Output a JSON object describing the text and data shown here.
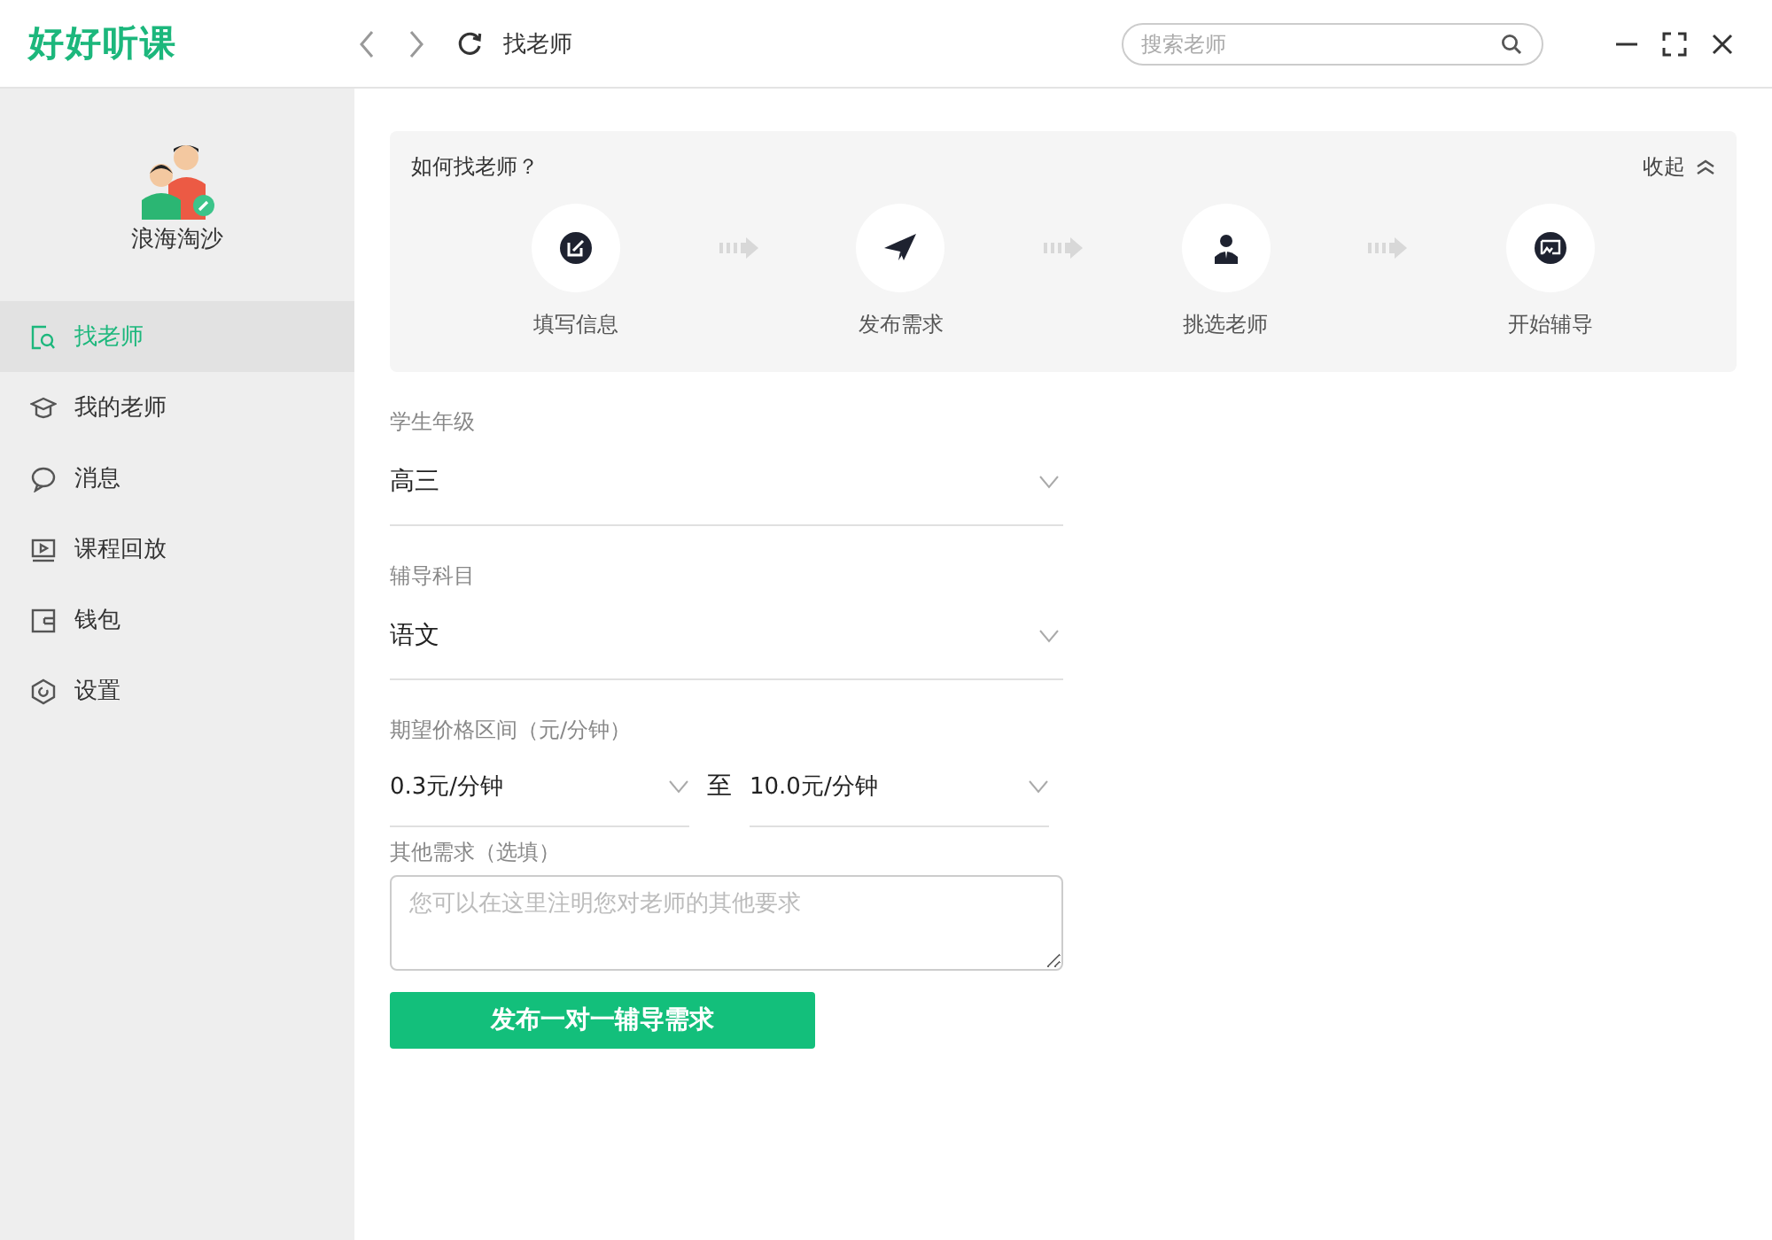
{
  "app": {
    "logo": "好好听课"
  },
  "toolbar": {
    "page_title": "找老师",
    "search": {
      "placeholder": "搜索老师"
    }
  },
  "sidebar": {
    "user": {
      "name": "浪海淘沙"
    },
    "items": [
      {
        "label": "找老师",
        "kind": "find",
        "selected": true
      },
      {
        "label": "我的老师",
        "kind": "teachers",
        "selected": false
      },
      {
        "label": "消息",
        "kind": "messages",
        "selected": false
      },
      {
        "label": "课程回放",
        "kind": "playback",
        "selected": false
      },
      {
        "label": "钱包",
        "kind": "wallet",
        "selected": false
      },
      {
        "label": "设置",
        "kind": "settings",
        "selected": false
      }
    ]
  },
  "guide": {
    "title": "如何找老师？",
    "collapse": "收起",
    "expanded": true,
    "steps": [
      {
        "label": "填写信息",
        "kind": "edit"
      },
      {
        "label": "发布需求",
        "kind": "send"
      },
      {
        "label": "挑选老师",
        "kind": "teacher"
      },
      {
        "label": "开始辅导",
        "kind": "board"
      }
    ]
  },
  "form": {
    "grade": {
      "label": "学生年级",
      "value": "高三"
    },
    "subject": {
      "label": "辅导科目",
      "value": "语文"
    },
    "price": {
      "label": "期望价格区间（元/分钟）",
      "min": "0.3元/分钟",
      "separator": "至",
      "max": "10.0元/分钟"
    },
    "notes": {
      "label": "其他需求（选填）",
      "placeholder": "您可以在这里注明您对老师的其他要求"
    },
    "submit": "发布一对一辅导需求"
  }
}
